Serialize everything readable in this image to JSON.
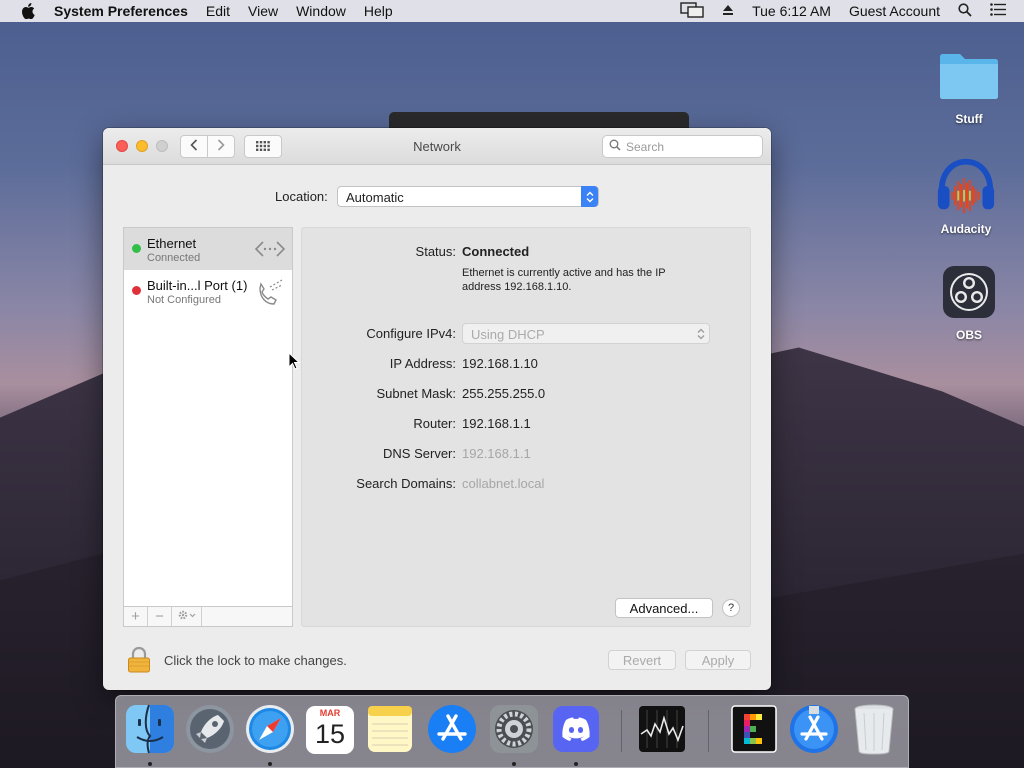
{
  "menubar": {
    "app_name": "System Preferences",
    "items": [
      "Edit",
      "View",
      "Window",
      "Help"
    ],
    "clock": "Tue 6:12 AM",
    "user": "Guest Account"
  },
  "window": {
    "title": "Network",
    "search_placeholder": "Search",
    "location_label": "Location:",
    "location_value": "Automatic",
    "services": [
      {
        "name": "Ethernet",
        "status": "Connected",
        "status_color": "#30c048",
        "icon": "ethernet-arrows-icon"
      },
      {
        "name": "Built-in...l Port (1)",
        "status": "Not Configured",
        "status_color": "#e0303a",
        "icon": "phone-modem-icon"
      }
    ],
    "detail": {
      "status_label": "Status:",
      "status_value": "Connected",
      "status_desc": "Ethernet is currently active and has the IP address 192.168.1.10.",
      "ipv4_label": "Configure IPv4:",
      "ipv4_value": "Using DHCP",
      "ip_label": "IP Address:",
      "ip_value": "192.168.1.10",
      "subnet_label": "Subnet Mask:",
      "subnet_value": "255.255.255.0",
      "router_label": "Router:",
      "router_value": "192.168.1.1",
      "dns_label": "DNS Server:",
      "dns_value": "192.168.1.1",
      "domains_label": "Search Domains:",
      "domains_value": "collabnet.local",
      "advanced_label": "Advanced...",
      "help_label": "?"
    },
    "footer": {
      "lock_text": "Click the lock to make changes.",
      "revert_label": "Revert",
      "apply_label": "Apply"
    }
  },
  "desktop": {
    "icons": [
      {
        "label": "Stuff",
        "icon": "folder-icon"
      },
      {
        "label": "Audacity",
        "icon": "audacity-icon"
      },
      {
        "label": "OBS",
        "icon": "obs-icon"
      }
    ]
  },
  "dock": {
    "apps": [
      "Finder",
      "Launchpad",
      "Safari",
      "Calendar",
      "Notes",
      "App Store",
      "System Preferences",
      "Discord",
      "Stocks",
      "Emacs",
      "Xcode",
      "Trash"
    ],
    "calendar_month": "MAR",
    "calendar_day": "15"
  }
}
